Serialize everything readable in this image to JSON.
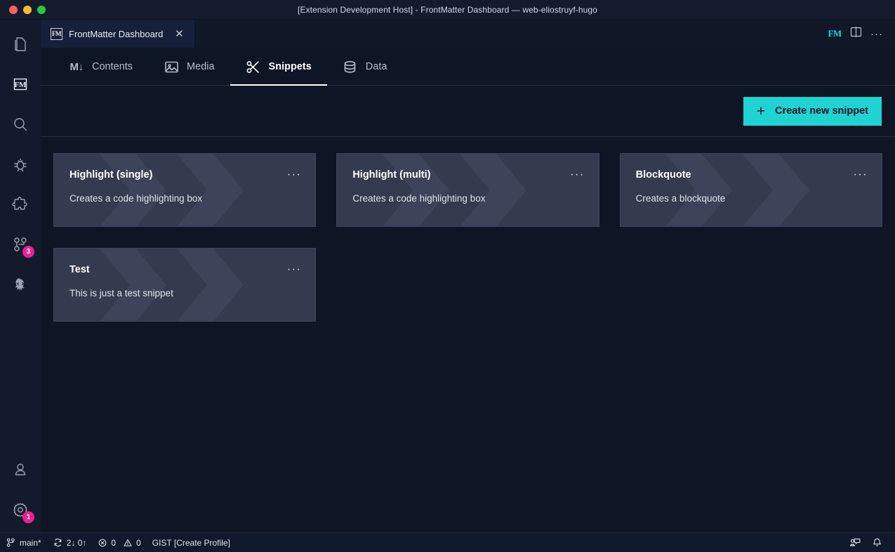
{
  "window": {
    "title": "[Extension Development Host] - FrontMatter Dashboard — web-eliostruyf-hugo",
    "traffic_lights": [
      "close",
      "minimize",
      "zoom"
    ]
  },
  "activity_bar": {
    "items": [
      {
        "name": "explorer",
        "icon": "files-icon",
        "badge": null
      },
      {
        "name": "frontmatter",
        "icon": "fm-icon",
        "badge": null
      },
      {
        "name": "search",
        "icon": "search-icon",
        "badge": null
      },
      {
        "name": "run-and-debug",
        "icon": "debug-icon",
        "badge": null
      },
      {
        "name": "extensions",
        "icon": "extensions-icon",
        "badge": null
      },
      {
        "name": "source-control",
        "icon": "source-control-icon",
        "badge": "3"
      },
      {
        "name": "azure",
        "icon": "octopus-icon",
        "badge": null
      }
    ],
    "bottom_items": [
      {
        "name": "accounts",
        "icon": "account-icon",
        "badge": null
      },
      {
        "name": "manage",
        "icon": "gear-icon",
        "badge": "1"
      }
    ]
  },
  "editor_tabs": {
    "tabs": [
      {
        "label": "FrontMatter Dashboard",
        "icon": "fm-icon",
        "close": "✕",
        "active": true
      }
    ],
    "actions": [
      {
        "name": "frontmatter-action",
        "label": "FM"
      },
      {
        "name": "split-editor",
        "label": "split-editor-icon"
      },
      {
        "name": "more-actions",
        "label": "···"
      }
    ]
  },
  "dashboard": {
    "nav": [
      {
        "label": "Contents",
        "icon": "markdown-icon",
        "active": false
      },
      {
        "label": "Media",
        "icon": "image-icon",
        "active": false
      },
      {
        "label": "Snippets",
        "icon": "scissors-icon",
        "active": true
      },
      {
        "label": "Data",
        "icon": "database-icon",
        "active": false
      }
    ],
    "toolbar": {
      "create_label": "Create new snippet",
      "create_icon": "plus-icon"
    },
    "snippets": [
      {
        "title": "Highlight (single)",
        "description": "Creates a code highlighting box",
        "menu": "···"
      },
      {
        "title": "Highlight (multi)",
        "description": "Creates a code highlighting box",
        "menu": "···"
      },
      {
        "title": "Blockquote",
        "description": "Creates a blockquote",
        "menu": "···"
      },
      {
        "title": "Test",
        "description": "This is just a test snippet",
        "menu": "···"
      }
    ]
  },
  "status_bar": {
    "left": [
      {
        "name": "branch",
        "icon": "source-control-icon",
        "label": "main*"
      },
      {
        "name": "sync",
        "icon": "sync-icon",
        "label": "2↓ 0↑"
      },
      {
        "name": "problems",
        "icon": "error-warning-icon",
        "label": "0  0",
        "errors": "0",
        "warnings": "0"
      },
      {
        "name": "gist-profile",
        "icon": null,
        "label": "GIST [Create Profile]"
      }
    ],
    "right": [
      {
        "name": "feedback",
        "icon": "feedback-icon",
        "label": ""
      },
      {
        "name": "notifications",
        "icon": "bell-icon",
        "label": ""
      }
    ]
  },
  "colors": {
    "accent": "#1fd3d3",
    "badge": "#f01f90",
    "card_bg": "#343b4f",
    "app_bg": "#0e1525"
  }
}
